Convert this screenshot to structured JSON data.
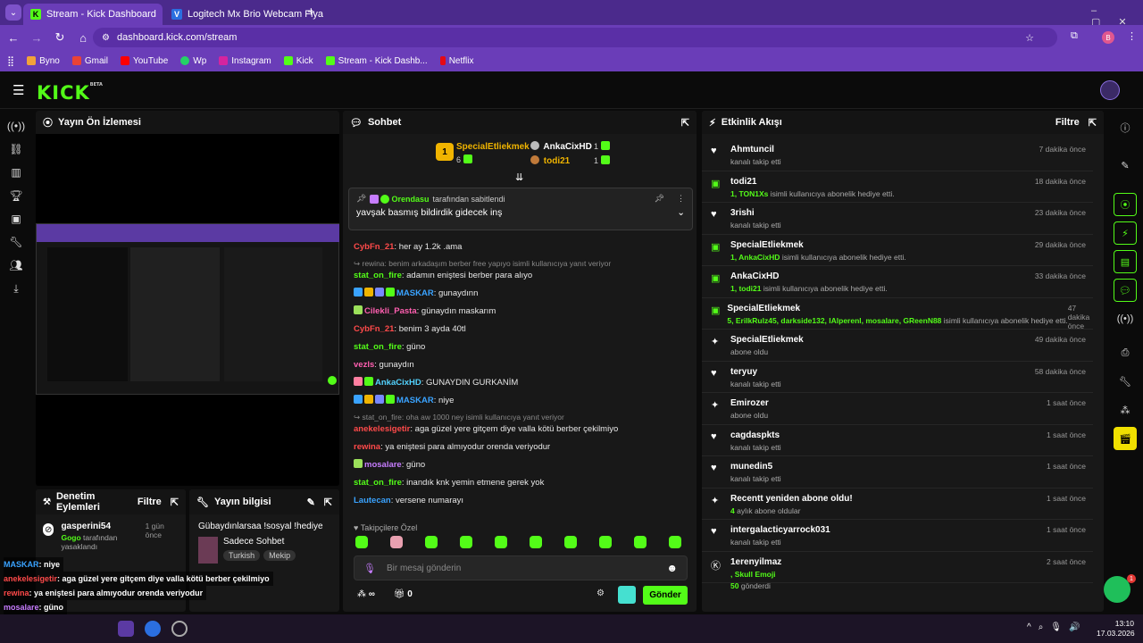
{
  "browser": {
    "tabs": [
      {
        "title": "Stream - Kick Dashboard",
        "active": true
      },
      {
        "title": "Logitech Mx Brio Webcam Fiya",
        "active": false
      }
    ],
    "new_tab": "+",
    "url": "dashboard.kick.com/stream",
    "profile_initial": "B",
    "bookmarks": [
      "Byno",
      "Gmail",
      "YouTube",
      "Wp",
      "Instagram",
      "Kick",
      "Stream - Kick Dashb...",
      "Netflix"
    ]
  },
  "kick": {
    "logo": "KICK",
    "beta": "BETA"
  },
  "preview": {
    "title": "Yayın Ön İzlemesi"
  },
  "moderation": {
    "title": "Denetim Eylemleri",
    "filter": "Filtre",
    "item": {
      "user": "gasperini54",
      "time": "1 gün önce",
      "by": "Gogo",
      "action": "tarafından yasaklandı"
    }
  },
  "streaminfo": {
    "title": "Yayın bilgisi",
    "stream_title": "Gübaydınlarsaa !sosyal !hediye",
    "category": "Sadece Sohbet",
    "tags": [
      "Turkish",
      "Mekip"
    ]
  },
  "chat": {
    "title": "Sohbet",
    "leaders": [
      {
        "rank": "1",
        "name": "SpecialEtliekmek",
        "count": "6"
      },
      {
        "name": "AnkaCixHD",
        "count": "1"
      },
      {
        "name": "todi21",
        "count": "1"
      }
    ],
    "pinned": {
      "by": "Orendasu",
      "by_suffix": "tarafından sabitlendi",
      "text": "yavşak basmış bildirdik gidecek inş"
    },
    "messages": [
      {
        "user": "CybFn_21",
        "color": "#ff4a4a",
        "text": "her ay 1.2k .ama"
      },
      {
        "reply": "rewina: benim arkadaşım berber free yapıyo isimli kullanıcıya yanıt veriyor",
        "user": "stat_on_fire",
        "color": "#53fc18",
        "text": "adamın eniştesi berber para alıyo"
      },
      {
        "user": "MASKAR",
        "color": "#3aa3ff",
        "text": "gunaydınn",
        "badges": [
          "#3aa3ff",
          "#f0b400",
          "#7788ff",
          "#53fc18"
        ]
      },
      {
        "user": "Cilekli_Pasta",
        "color": "#ff5fb0",
        "text": "günaydın maskarım",
        "badges": [
          "#9be05a"
        ]
      },
      {
        "user": "CybFn_21",
        "color": "#ff4a4a",
        "text": "benim 3 ayda 40tl"
      },
      {
        "user": "stat_on_fire",
        "color": "#53fc18",
        "text": "güno"
      },
      {
        "user": "vezls",
        "color": "#ff5fb0",
        "text": "gunaydın"
      },
      {
        "user": "AnkaCixHD",
        "color": "#53d3ff",
        "text": "GUNAYDIN GURKANİM",
        "badges": [
          "#ff7fa0",
          "#53fc18"
        ]
      },
      {
        "user": "MASKAR",
        "color": "#3aa3ff",
        "text": "niye",
        "badges": [
          "#3aa3ff",
          "#f0b400",
          "#7788ff",
          "#53fc18"
        ]
      },
      {
        "reply": "stat_on_fire: oha aw 1000 ney isimli kullanıcıya yanıt veriyor",
        "user": "anekelesigetir",
        "color": "#ff4a4a",
        "text": "aga güzel yere gitçem diye valla kötü berber çekilmiyo"
      },
      {
        "user": "rewina",
        "color": "#ff4a4a",
        "text": "ya eniştesi para almıyodur orenda veriyodur"
      },
      {
        "user": "mosalare",
        "color": "#c77dff",
        "text": "güno",
        "badges": [
          "#9be05a"
        ]
      },
      {
        "user": "stat_on_fire",
        "color": "#53fc18",
        "text": "inandık knk yemin etmene gerek yok"
      },
      {
        "user": "Lautecan",
        "color": "#3aa3ff",
        "text": "versene numarayı"
      }
    ],
    "emote_label": "Takipçilere Özel",
    "input_placeholder": "Bir mesaj gönderin",
    "points_left": "∞",
    "points_right": "0",
    "send": "Gönder"
  },
  "activity": {
    "title": "Etkinlik Akışı",
    "filter": "Filtre",
    "items": [
      {
        "icon": "heart-icon",
        "name": "Ahmtuncil",
        "sub": "kanalı takip etti",
        "time": "7 dakika önce"
      },
      {
        "icon": "gift-icon",
        "name": "todi21",
        "sub_green": "1, TON1Xs",
        "sub": "isimli kullanıcıya abonelik hediye etti.",
        "time": "18 dakika önce"
      },
      {
        "icon": "heart-icon",
        "name": "3rishi",
        "sub": "kanalı takip etti",
        "time": "23 dakika önce"
      },
      {
        "icon": "gift-icon",
        "name": "SpecialEtliekmek",
        "sub_green": "1, AnkaCixHD",
        "sub": "isimli kullanıcıya abonelik hediye etti.",
        "time": "29 dakika önce"
      },
      {
        "icon": "gift-icon",
        "name": "AnkaCixHD",
        "sub_green": "1, todi21",
        "sub": "isimli kullanıcıya abonelik hediye etti.",
        "time": "33 dakika önce"
      },
      {
        "icon": "gift-icon",
        "name": "SpecialEtliekmek",
        "sub_green": "5, ErilkRulz45, darkside132, IAlperenl, mosalare, GReenN88",
        "sub": "isimli kullanıcıya abonelik hediye etti.",
        "time": "47 dakika önce"
      },
      {
        "icon": "sparkle-icon",
        "name": "SpecialEtliekmek",
        "sub": "abone oldu",
        "time": "49 dakika önce"
      },
      {
        "icon": "heart-icon",
        "name": "teryuy",
        "sub": "kanalı takip etti",
        "time": "58 dakika önce"
      },
      {
        "icon": "sparkle-icon",
        "name": "Emirozer",
        "sub": "abone oldu",
        "time": "1 saat önce"
      },
      {
        "icon": "heart-icon",
        "name": "cagdaspkts",
        "sub": "kanalı takip etti",
        "time": "1 saat önce"
      },
      {
        "icon": "heart-icon",
        "name": "munedin5",
        "sub": "kanalı takip etti",
        "time": "1 saat önce"
      },
      {
        "icon": "sparkle-icon",
        "name": "Recentt yeniden abone oldu!",
        "sub_green": "4",
        "sub": "aylık abone oldular",
        "time": "1 saat önce"
      },
      {
        "icon": "heart-icon",
        "name": "intergalacticyarrock031",
        "sub": "kanalı takip etti",
        "time": "1 saat önce"
      },
      {
        "icon": "kick-icon",
        "name": "1erenyilmaz",
        "sub_green": ", Skull Emoji",
        "sub2": "50",
        "sub3": "gönderdi",
        "time": "2 saat önce"
      }
    ]
  },
  "overlay": [
    {
      "user": "MASKAR",
      "color": "#3aa3ff",
      "text": ": niye"
    },
    {
      "user": "anekelesigetir",
      "color": "#ff4a4a",
      "text": ": aga güzel yere gitçem diye valla kötü berber çekilmiyo"
    },
    {
      "user": "rewina",
      "color": "#ff4a4a",
      "text": ": ya eniştesi para almıyodur orenda veriyodur"
    },
    {
      "user": "mosalare",
      "color": "#c77dff",
      "text": ": güno"
    },
    {
      "user": "stat_on_fire",
      "color": "#53fc18",
      "text": ": inandık knk yemin etmene gerek yok"
    },
    {
      "user": "Lautecan",
      "color": "#3aa3ff",
      "text": ": versene numarayı"
    }
  ],
  "taskbar": {
    "time": "13:10",
    "date": "17.03.2026"
  },
  "colors": {
    "accent": "#53fc18",
    "browser": "#6a3db8",
    "panel": "#181818"
  }
}
